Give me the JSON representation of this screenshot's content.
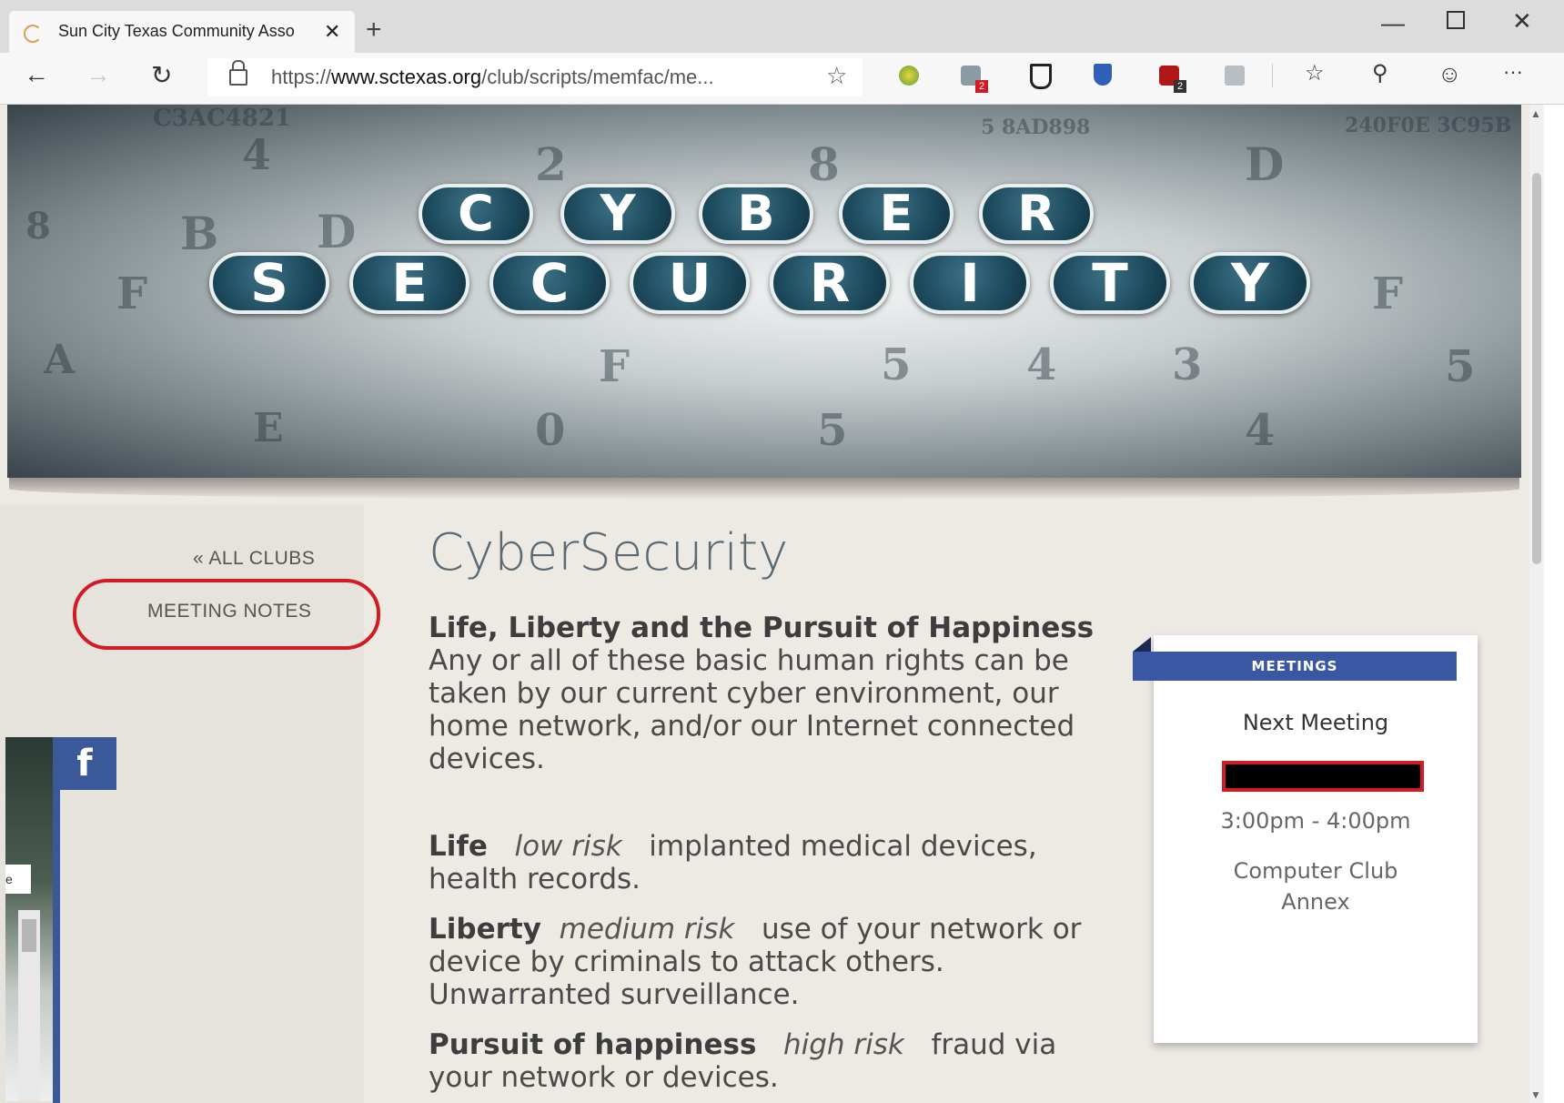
{
  "browser": {
    "tab_title": "Sun City Texas Community Asso",
    "tab_close": "✕",
    "new_tab": "+",
    "window": {
      "minimize": "—",
      "close": "✕"
    },
    "nav": {
      "back": "←",
      "forward": "→",
      "refresh": "↻",
      "more": "···"
    },
    "url_prefix": "https://",
    "url_domain": "www.sctexas.org",
    "url_path": "/club/scripts/memfac/me...",
    "favorite_star": "☆",
    "toolbar_icons": [
      "favorites-icon",
      "profile-icon",
      "emoji-feedback-icon"
    ],
    "badges": [
      "2",
      "2"
    ]
  },
  "banner": {
    "row1": [
      "C",
      "Y",
      "B",
      "E",
      "R"
    ],
    "row2": [
      "S",
      "E",
      "C",
      "U",
      "R",
      "I",
      "T",
      "Y"
    ]
  },
  "sidebar": {
    "all_clubs": "« ALL CLUBS",
    "meeting_notes": "MEETING NOTES",
    "facebook_letter": "f",
    "facebook_label": "e"
  },
  "main": {
    "title": "CyberSecurity",
    "intro_bold": "Life, Liberty and the Pursuit of Happiness",
    "intro_text": " Any or all of these basic human rights can be taken by our current cyber environment, our home network, and/or our Internet connected devices.",
    "life_label": "Life",
    "life_risk": "low risk",
    "life_text": "implanted medical devices, health records.",
    "liberty_label": "Liberty",
    "liberty_risk": "medium risk",
    "liberty_text": "use of your network or device by criminals to attack others. Unwarranted surveillance.",
    "pursuit_label": "Pursuit of happiness",
    "pursuit_risk": "high risk",
    "pursuit_text": "fraud via your network or devices."
  },
  "meetings": {
    "header": "MEETINGS",
    "next_label": "Next Meeting",
    "time": "3:00pm - 4:00pm",
    "place": "Computer Club Annex"
  },
  "colors": {
    "accent_blue": "#3a57a4",
    "annotation_red": "#d01c24",
    "facebook_blue": "#3b5998"
  }
}
